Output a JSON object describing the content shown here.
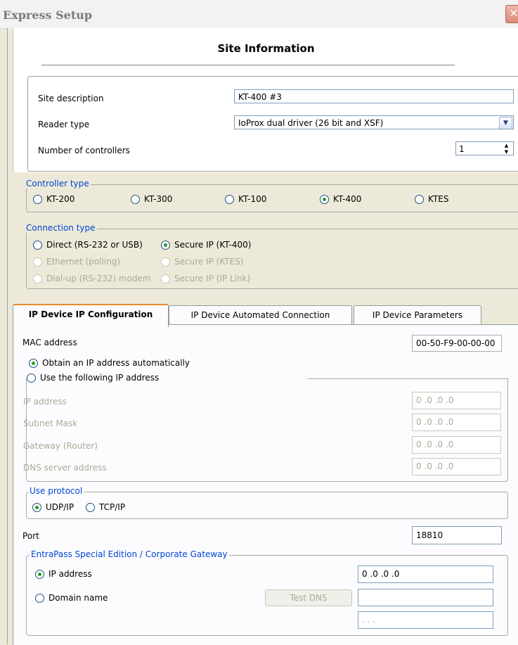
{
  "window": {
    "title": "Express Setup"
  },
  "site": {
    "heading": "Site Information",
    "description_label": "Site description",
    "description_value": "KT-400 #3",
    "reader_label": "Reader type",
    "reader_value": "IoProx dual driver (26 bit and XSF)",
    "controllers_label": "Number of controllers",
    "controllers_value": "1"
  },
  "controller_type": {
    "title": "Controller type",
    "options": [
      "KT-200",
      "KT-300",
      "KT-100",
      "KT-400",
      "KTES"
    ],
    "selected": "KT-400"
  },
  "connection_type": {
    "title": "Connection type",
    "options": [
      "Direct (RS-232 or USB)",
      "Secure IP (KT-400)",
      "Ethernet (polling)",
      "Secure IP (KTES)",
      "Dial-up (RS-232) modem",
      "Secure IP (IP Link)"
    ],
    "selected": "Secure IP (KT-400)"
  },
  "tabs": [
    "IP Device IP Configuration",
    "IP Device Automated Connection",
    "IP Device Parameters"
  ],
  "ipconfig": {
    "mac_label": "MAC address",
    "mac_value": "00-50-F9-00-00-00",
    "obtain_auto": "Obtain an IP address automatically",
    "use_following": "Use the following IP address",
    "ip_label": "IP address",
    "subnet_label": "Subnet Mask",
    "gateway_label": "Gateway (Router)",
    "dns_label": "DNS server address",
    "ip_value": "0 .0 .0 .0",
    "subnet_value": "0 .0 .0 .0",
    "gateway_value": "0 .0 .0 .0",
    "dns_value": "0 .0 .0 .0"
  },
  "protocol": {
    "title": "Use protocol",
    "options": [
      "UDP/IP",
      "TCP/IP"
    ],
    "selected": "UDP/IP"
  },
  "port": {
    "label": "Port",
    "value": "18810"
  },
  "gateway": {
    "title": "EntraPass Special Edition / Corporate Gateway",
    "ip_label": "IP address",
    "ip_value": "0 .0 .0 .0",
    "domain_label": "Domain name",
    "test_dns": "Test DNS",
    "domain_value": "",
    "ip_placeholder": " .  .  ."
  }
}
